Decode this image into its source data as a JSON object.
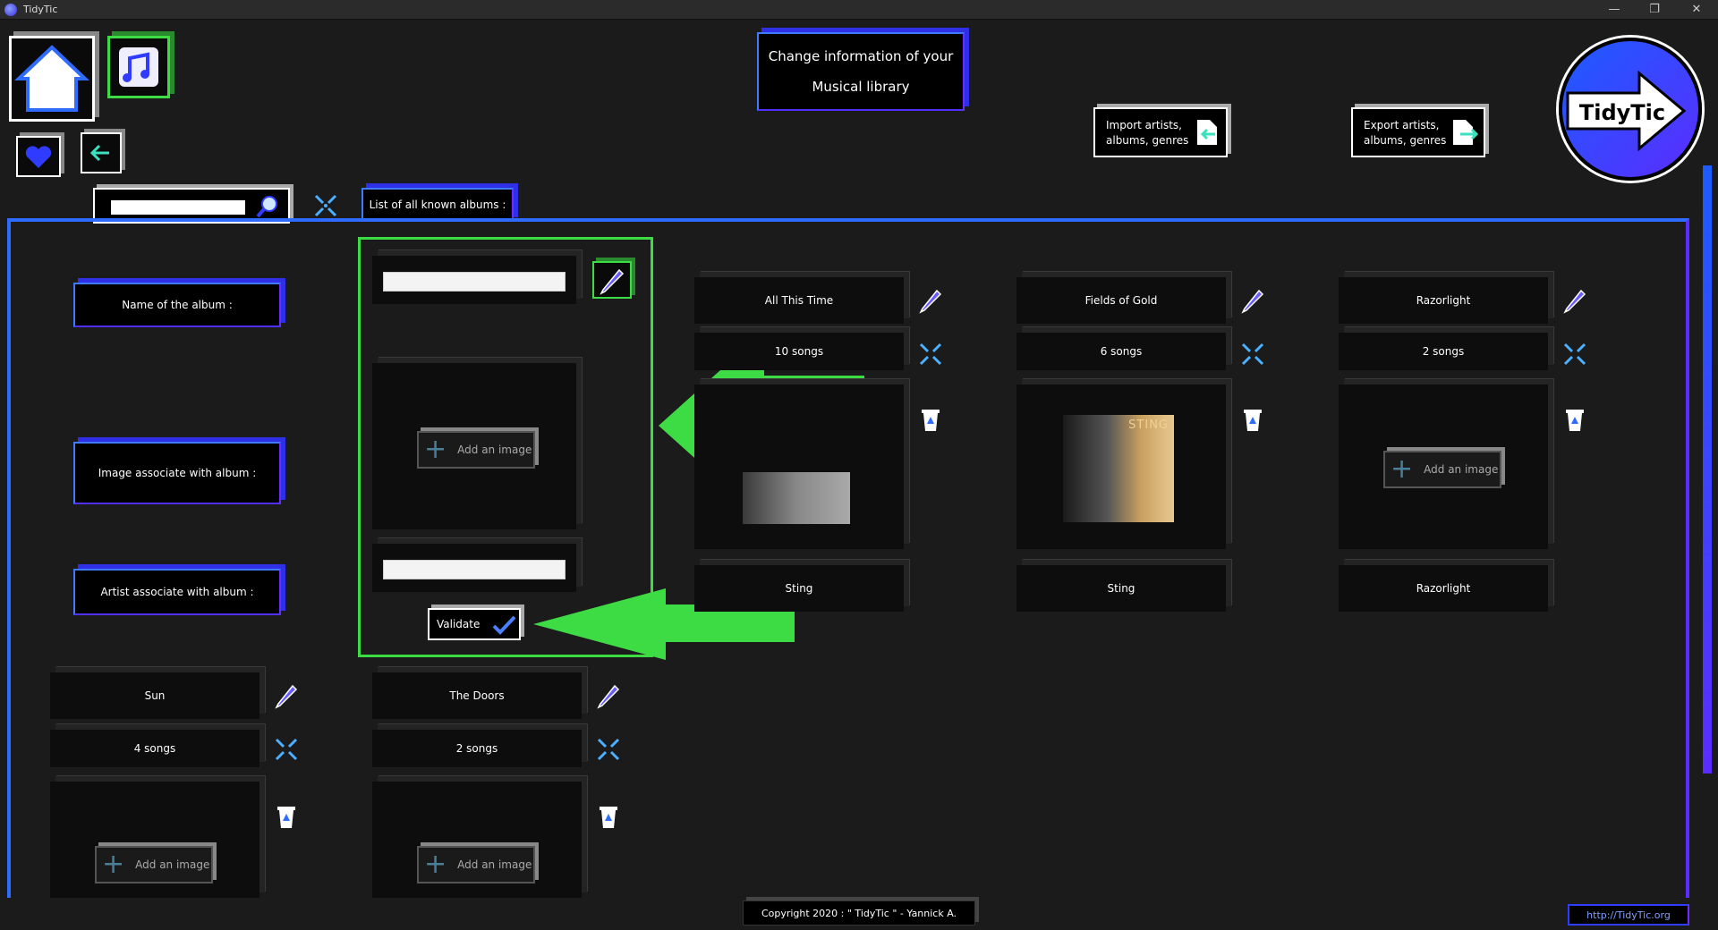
{
  "window": {
    "title": "TidyTic",
    "minimize": "—",
    "restore": "❐",
    "close": "✕"
  },
  "header": {
    "page_title_line1": "Change information of your",
    "page_title_line2": "Musical library",
    "import_label_line1": "Import artists,",
    "import_label_line2": "albums, genres",
    "export_label_line1": "Export artists,",
    "export_label_line2": "albums, genres",
    "logo_text": "TidyTic"
  },
  "toolbar": {
    "list_tab_label": "List of all known albums :",
    "search_placeholder": ""
  },
  "form": {
    "name_label": "Name of the album :",
    "image_label": "Image associate with album :",
    "artist_label": "Artist associate with album :",
    "name_value": "",
    "artist_value": "",
    "add_image_label": "Add an image",
    "validate_label": "Validate"
  },
  "albums": [
    {
      "name": "All This Time",
      "songs": "10 songs",
      "artist": "Sting"
    },
    {
      "name": "Fields of Gold",
      "songs": "6 songs",
      "artist": "Sting",
      "cover_text": "STING"
    },
    {
      "name": "Razorlight",
      "songs": "2 songs",
      "artist": "Razorlight",
      "add_image_label": "Add an image"
    },
    {
      "name": "Sun",
      "songs": "4 songs",
      "add_image_label": "Add an image"
    },
    {
      "name": "The Doors",
      "songs": "2 songs",
      "add_image_label": "Add an image"
    }
  ],
  "footer": {
    "copyright": "Copyright 2020 : \" TidyTic \" - Yannick A.",
    "link": "http://TidyTic.org"
  },
  "colors": {
    "accent_blue": "#2f6bff",
    "accent_purple": "#5a2cff",
    "highlight_green": "#3edc44",
    "background": "#1b1b1b"
  }
}
